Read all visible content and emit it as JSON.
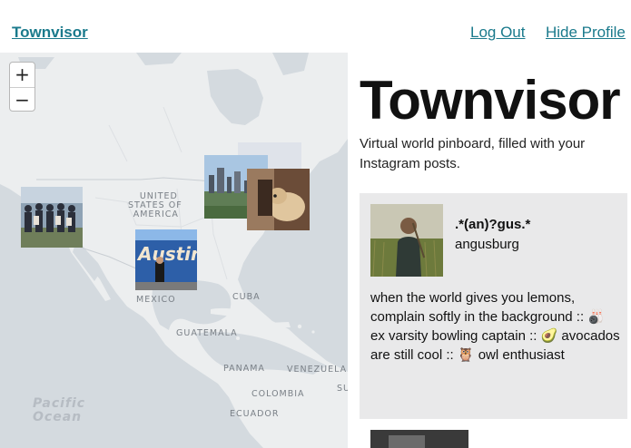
{
  "nav": {
    "brand": "Townvisor",
    "logout": "Log Out",
    "hide_profile": "Hide Profile"
  },
  "map": {
    "zoom_in": "+",
    "zoom_out": "−",
    "labels": {
      "usa_line1": "UNITED",
      "usa_line2": "STATES OF",
      "usa_line3": "AMERICA",
      "mexico": "MEXICO",
      "cuba": "CUBA",
      "guatemala": "GUATEMALA",
      "panama": "PANAMA",
      "venezuela": "VENEZUELA",
      "colombia": "COLOMBIA",
      "ecuador": "ECUADOR",
      "su": "SU",
      "pacific": "Pacific",
      "ocean": "Ocean"
    },
    "markers": [
      {
        "name": "group-photo-west"
      },
      {
        "name": "austin-mural-photo"
      },
      {
        "name": "city-skyline-photo"
      },
      {
        "name": "sky-photo"
      },
      {
        "name": "dog-photo"
      }
    ]
  },
  "profile": {
    "title": "Townvisor",
    "subtitle": "Virtual world pinboard, filled with your Instagram posts.",
    "user": {
      "handle": ".*(an)?gus.*",
      "username": "angusburg",
      "bio": "when the world gives you lemons, complain softly in the background :: 🎳 ex varsity bowling captain :: 🥑 avocados are still cool :: 🦉 owl enthusiast"
    }
  }
}
